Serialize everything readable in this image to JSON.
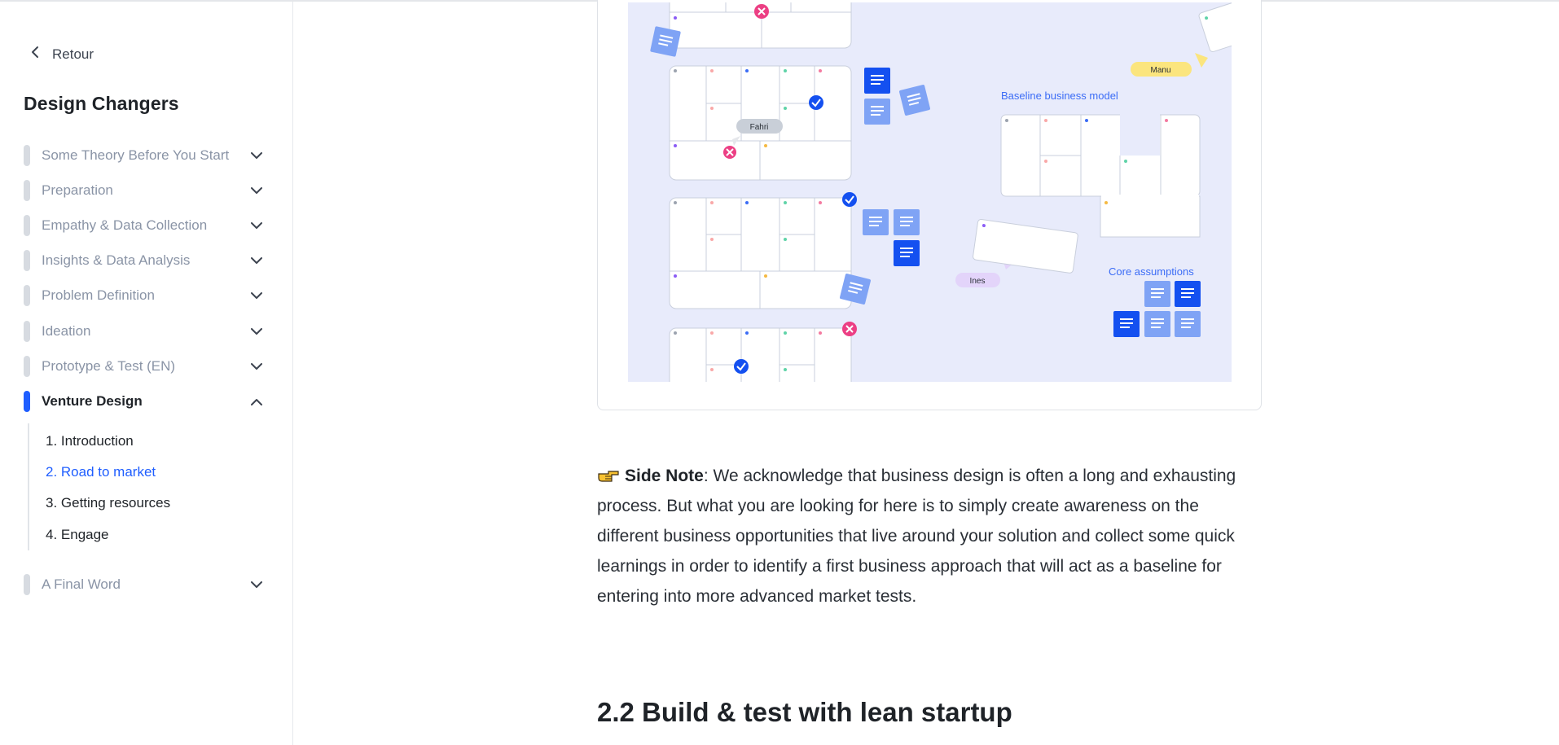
{
  "sidebar": {
    "back_label": "Retour",
    "course_title": "Design Changers",
    "sections": [
      {
        "label": "Some Theory Before You Start",
        "expanded": false
      },
      {
        "label": "Preparation",
        "expanded": false
      },
      {
        "label": "Empathy & Data Collection",
        "expanded": false
      },
      {
        "label": "Insights & Data Analysis",
        "expanded": false
      },
      {
        "label": "Problem Definition",
        "expanded": false
      },
      {
        "label": "Ideation",
        "expanded": false
      },
      {
        "label": "Prototype & Test (EN)",
        "expanded": false
      },
      {
        "label": "Venture Design",
        "expanded": true
      },
      {
        "label": "A Final Word",
        "expanded": false
      }
    ],
    "subitems": [
      {
        "label": "1. Introduction"
      },
      {
        "label": "2. Road to market",
        "current": true
      },
      {
        "label": "3. Getting resources"
      },
      {
        "label": "4. Engage"
      }
    ]
  },
  "figure": {
    "cursor_names": [
      "Fahri",
      "Manu",
      "Ines"
    ],
    "labels": {
      "baseline": "Baseline business model",
      "core": "Core assumptions"
    }
  },
  "note": {
    "lead": "Side Note",
    "text": ": We acknowledge that business design is often a long and exhausting process. But what you are looking for here is to simply create awareness on the different business opportunities that live around your solution and collect some quick learnings in order to identify a first business approach that will act as a baseline for entering into more advanced market tests."
  },
  "heading": "2.2 Build & test with lean startup",
  "colors": {
    "accent": "#1f5eff",
    "sticky_light": "#7fa3f5",
    "sticky_dark": "#1450f0",
    "figure_bg": "#e8ebfb"
  }
}
